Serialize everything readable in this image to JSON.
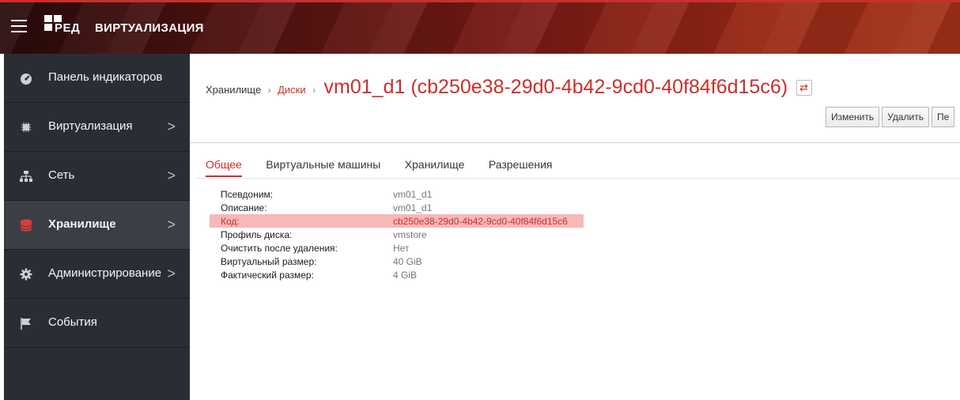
{
  "header": {
    "logo_text": "РЕД",
    "product_title": "ВИРТУАЛИЗАЦИЯ"
  },
  "sidebar": {
    "items": [
      {
        "label": "Панель индикаторов",
        "icon": "dashboard-icon",
        "has_chevron": false,
        "active": false
      },
      {
        "label": "Виртуализация",
        "icon": "chip-icon",
        "has_chevron": true,
        "active": false
      },
      {
        "label": "Сеть",
        "icon": "network-icon",
        "has_chevron": true,
        "active": false
      },
      {
        "label": "Хранилище",
        "icon": "database-icon",
        "has_chevron": true,
        "active": true
      },
      {
        "label": "Администрирование",
        "icon": "gear-icon",
        "has_chevron": true,
        "active": false
      },
      {
        "label": "События",
        "icon": "flag-icon",
        "has_chevron": false,
        "active": false
      }
    ],
    "chevron": ">"
  },
  "breadcrumb": {
    "root": "Хранилище",
    "separator": "›",
    "parent": "Диски",
    "title": "vm01_d1 (cb250e38-29d0-4b42-9cd0-40f84f6d15c6)",
    "swap_glyph": "⇄"
  },
  "actions": {
    "edit": "Изменить",
    "delete": "Удалить",
    "more": "Пе"
  },
  "tabs": [
    "Общее",
    "Виртуальные машины",
    "Хранилище",
    "Разрешения"
  ],
  "details": [
    {
      "label": "Псевдоним:",
      "value": "vm01_d1"
    },
    {
      "label": "Описание:",
      "value": "vm01_d1"
    },
    {
      "label": "Код:",
      "value": "cb250e38-29d0-4b42-9cd0-40f84f6d15c6",
      "highlight": true
    },
    {
      "label": "Профиль диска:",
      "value": "vmstore"
    },
    {
      "label": "Очистить после удаления:",
      "value": "Нет"
    },
    {
      "label": "Виртуальный размер:",
      "value": "40 GiB"
    },
    {
      "label": "Фактический размер:",
      "value": "4 GiB"
    }
  ],
  "colors": {
    "accent": "#c9302c",
    "sidebar_bg": "#292e34",
    "sidebar_active": "#393f44",
    "highlight_row": "#f8b8b8"
  }
}
